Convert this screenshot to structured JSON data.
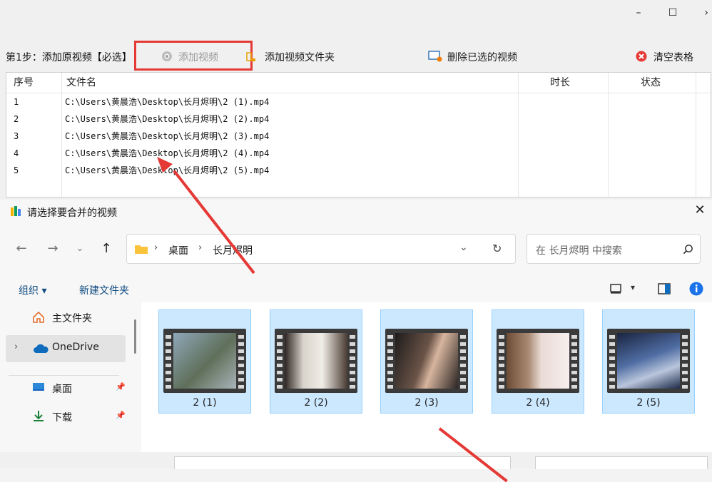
{
  "window": {
    "minimize": "–",
    "maximize": "☐",
    "close": "›"
  },
  "toolbar": {
    "step_label": "第1步：添加原视频【必选】",
    "add_video": "添加视频",
    "add_folder": "添加视频文件夹",
    "delete_selected": "删除已选的视频",
    "clear_table": "清空表格"
  },
  "table": {
    "headers": {
      "index": "序号",
      "filename": "文件名",
      "duration": "时长",
      "status": "状态"
    },
    "rows": [
      {
        "index": "1",
        "filename": "C:\\Users\\黄晨浩\\Desktop\\长月烬明\\2 (1).mp4"
      },
      {
        "index": "2",
        "filename": "C:\\Users\\黄晨浩\\Desktop\\长月烬明\\2 (2).mp4"
      },
      {
        "index": "3",
        "filename": "C:\\Users\\黄晨浩\\Desktop\\长月烬明\\2 (3).mp4"
      },
      {
        "index": "4",
        "filename": "C:\\Users\\黄晨浩\\Desktop\\长月烬明\\2 (4).mp4"
      },
      {
        "index": "5",
        "filename": "C:\\Users\\黄晨浩\\Desktop\\长月烬明\\2 (5).mp4"
      }
    ]
  },
  "dialog": {
    "title": "请选择要合并的视频",
    "close": "✕",
    "breadcrumb": [
      "桌面",
      "长月烬明"
    ],
    "search_placeholder": "在 长月烬明 中搜索",
    "organize": "组织 ▾",
    "new_folder": "新建文件夹",
    "sidebar": [
      {
        "label": "主文件夹",
        "icon": "home-icon"
      },
      {
        "label": "OneDrive",
        "icon": "cloud-icon"
      },
      {
        "label": "桌面",
        "icon": "desktop-icon"
      },
      {
        "label": "下载",
        "icon": "download-icon"
      }
    ],
    "files": [
      "2 (1)",
      "2 (2)",
      "2 (3)",
      "2 (4)",
      "2 (5)"
    ]
  },
  "colors": {
    "accent_red": "#e53935",
    "selection": "#cce8ff",
    "selection_border": "#99d1ff",
    "onedrive": "#0f6cbd"
  }
}
